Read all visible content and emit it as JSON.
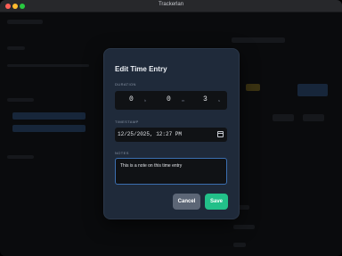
{
  "window": {
    "title": "Trackerlan"
  },
  "modal": {
    "title": "Edit Time Entry",
    "duration": {
      "label": "DURATION",
      "hours": "0",
      "hours_unit": "h",
      "minutes": "0",
      "minutes_unit": "m",
      "seconds": "3",
      "seconds_unit": "s"
    },
    "timestamp": {
      "label": "TIMESTAMP",
      "value": "12/25/2025, 12:27 PM"
    },
    "notes": {
      "label": "NOTES",
      "value": "This is a note on this time entry"
    },
    "cancel_label": "Cancel",
    "save_label": "Save"
  },
  "colors": {
    "accent_save": "#22c089",
    "focus_border": "#3b6fb0",
    "modal_bg": "#1f2a3a"
  }
}
